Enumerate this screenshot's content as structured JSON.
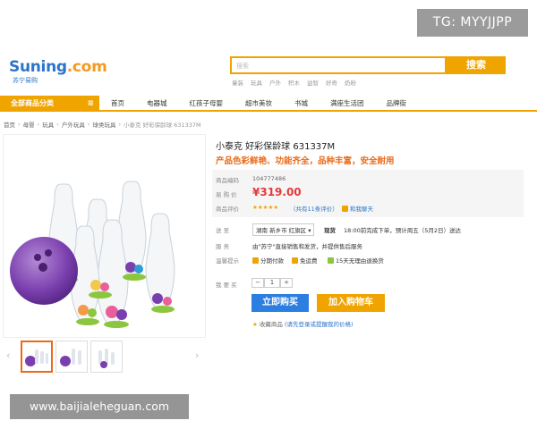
{
  "badge": "TG: MYYJJPP",
  "logo": {
    "main_blue": "Suning",
    "main_orange": ".com",
    "sub": "苏宁易购"
  },
  "search": {
    "placeholder": "搜索",
    "button": "搜索",
    "hot_words": [
      "童装",
      "玩具",
      "户外",
      "积木",
      "益智",
      "好奇",
      "奶粉"
    ]
  },
  "nav": {
    "category": "全部商品分类",
    "items": [
      "首页",
      "电器城",
      "红孩子母婴",
      "超市美妆",
      "书城",
      "满座生活团",
      "品牌街"
    ]
  },
  "breadcrumb": [
    "首页",
    "母婴",
    "玩具",
    "户外玩具",
    "球类玩具",
    "小泰克 好彩保龄球 631337M"
  ],
  "product": {
    "title": "小泰克 好彩保龄球 631337M",
    "promo": "产品色彩鲜艳、功能齐全，品种丰富，安全耐用",
    "code_label": "商品编码",
    "code": "104777486",
    "price_label": "易 购 价",
    "price": "¥319.00",
    "review_label": "商品评价",
    "stars": "★★★★★",
    "review_count": "（共有11条评价）",
    "review_tag": "和我聊天"
  },
  "delivery": {
    "label": "送 至",
    "region": "湖南 新乡市 红旗区 ▾",
    "stock": "现货",
    "note": "18:00前完成下单，预计周五（5月2日）送达"
  },
  "service": {
    "label": "服 务",
    "text": "由\"苏宁\"直接销售和发货，并提供售后服务"
  },
  "tips": {
    "label": "温馨提示",
    "items": [
      "分期付款",
      "免运费",
      "15天无理由退换货"
    ]
  },
  "purchase": {
    "qty_label": "我 要 买",
    "minus": "−",
    "qty": "1",
    "plus": "+",
    "buy": "立即购买",
    "cart": "加入购物车",
    "fav_label": "收藏商品",
    "fav_link": "(请先登录或提醒我的价格)"
  },
  "watermark": "www.baijialeheguan.com",
  "colors": {
    "accent": "#f0a400",
    "price": "#e4393c",
    "brand_blue": "#2b74c9",
    "buy_blue": "#2c7ee0"
  }
}
